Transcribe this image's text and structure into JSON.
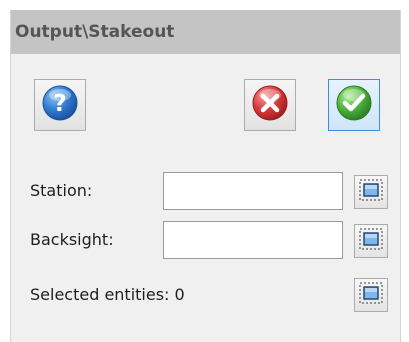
{
  "window": {
    "title": "Output\\Stakeout"
  },
  "buttons": {
    "help_icon": "help-icon",
    "cancel_icon": "cancel-icon",
    "ok_icon": "ok-icon"
  },
  "fields": {
    "station_label": "Station:",
    "station_value": "",
    "backsight_label": "Backsight:",
    "backsight_value": "",
    "selected_entities_label": "Selected entities: 0"
  },
  "icons": {
    "pick": "select-entity-icon"
  },
  "colors": {
    "title_bar_bg": "#c4c4c4",
    "title_text": "#555555",
    "panel_bg": "#f0f0f0",
    "help_blue": "#2f79d0",
    "cancel_red": "#d83a3a",
    "ok_green": "#4bb33b",
    "focus_border": "#3c8ddc"
  }
}
